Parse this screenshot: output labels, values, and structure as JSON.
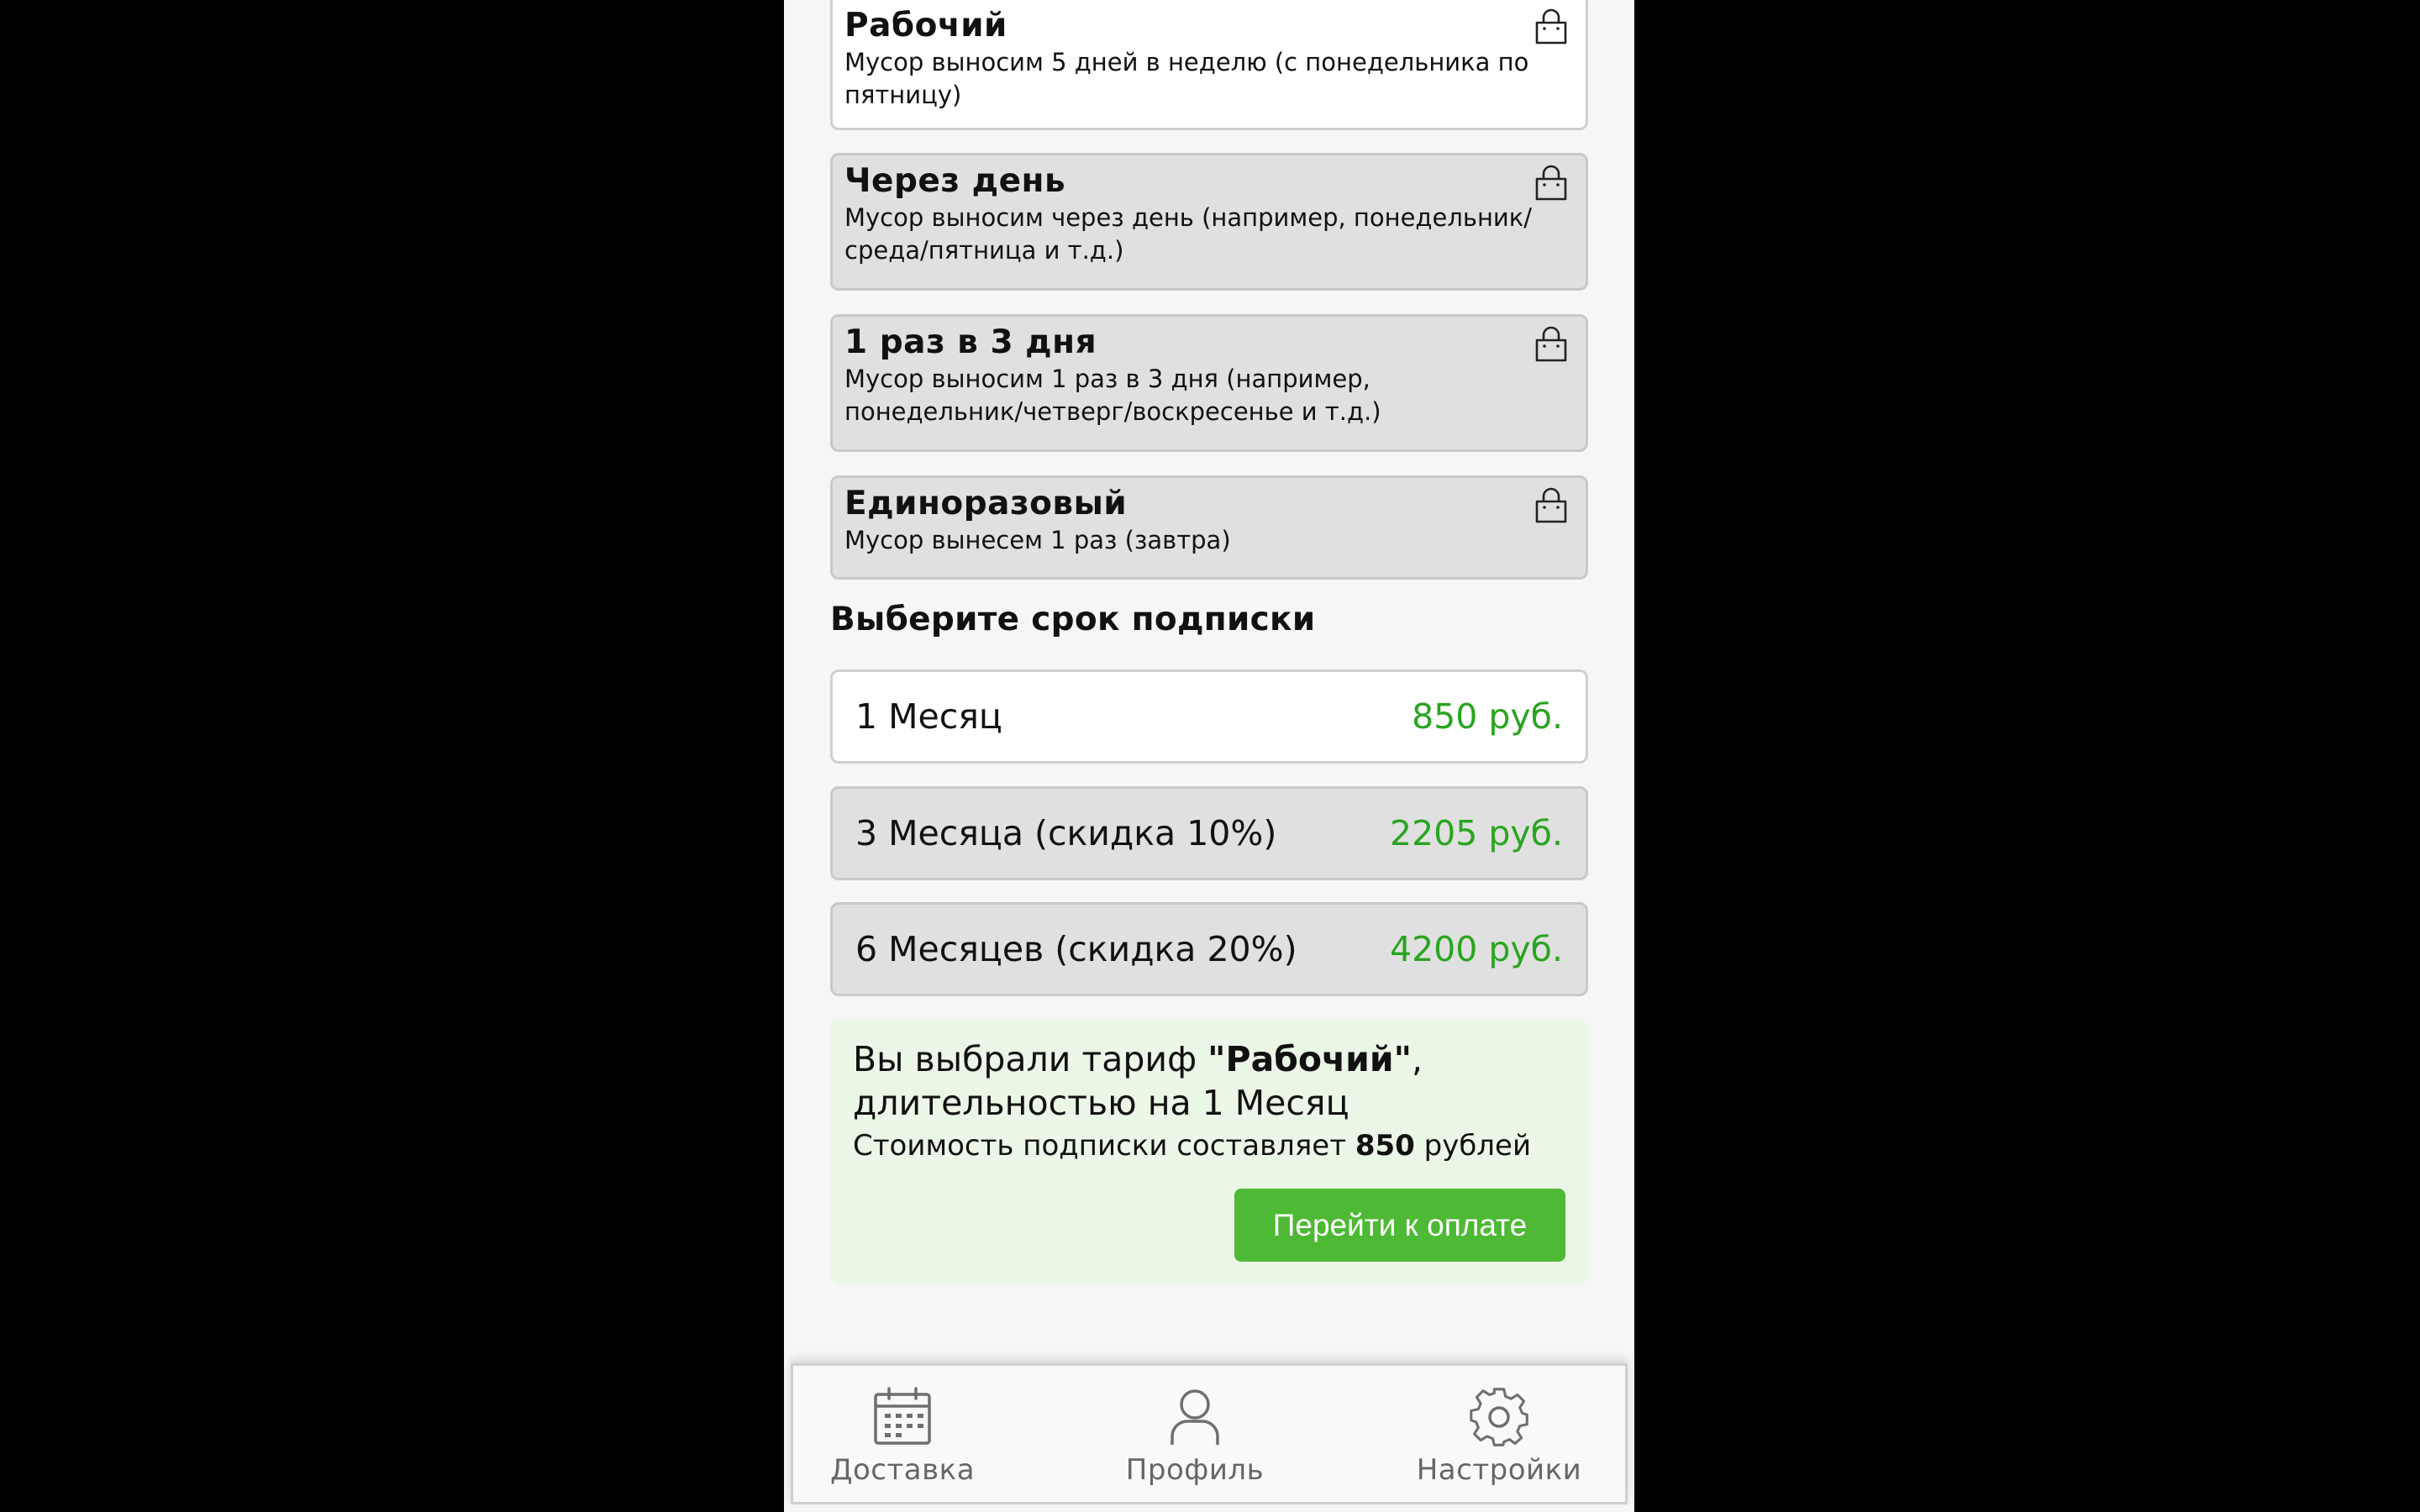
{
  "plans": [
    {
      "title": "Рабочий",
      "desc": "Мусор выносим 5 дней в неделю (с понедельника по пятницу)",
      "icon": "shopping-bag-icon"
    },
    {
      "title": "Через день",
      "desc": "Мусор выносим через день (например, понедельник/среда/пятница и т.д.)",
      "icon": "shopping-bag-icon"
    },
    {
      "title": "1 раз в 3 дня",
      "desc": "Мусор выносим 1 раз в 3 дня (например, понедельник/четверг/воскресенье и т.д.)",
      "icon": "shopping-bag-icon"
    },
    {
      "title": "Единоразовый",
      "desc": "Мусор вынесем 1 раз (завтра)",
      "icon": "shopping-bag-icon"
    }
  ],
  "term_heading": "Выберите срок подписки",
  "terms": [
    {
      "label": "1 Месяц",
      "price": "850 руб."
    },
    {
      "label": "3 Месяца (скидка 10%)",
      "price": "2205 руб."
    },
    {
      "label": "6 Месяцев (скидка 20%)",
      "price": "4200 руб."
    }
  ],
  "summary": {
    "prefix": "Вы выбрали тариф ",
    "plan_name": "\"Рабочий\"",
    "comma": ",",
    "duration_prefix": "длительностью на ",
    "duration": "1 Месяц",
    "cost_prefix": "Стоимость подписки составляет ",
    "cost": "850",
    "cost_suffix": " рублей",
    "button": "Перейти к оплате"
  },
  "tabs": [
    {
      "label": "Доставка",
      "icon": "calendar-icon"
    },
    {
      "label": "Профиль",
      "icon": "user-icon"
    },
    {
      "label": "Настройки",
      "icon": "gear-icon"
    }
  ],
  "colors": {
    "price_green": "#2aa420",
    "button_green": "#4db934",
    "summary_bg": "#eaf6e6",
    "card_unselected": "#e0e0e0",
    "card_selected": "#ffffff"
  }
}
